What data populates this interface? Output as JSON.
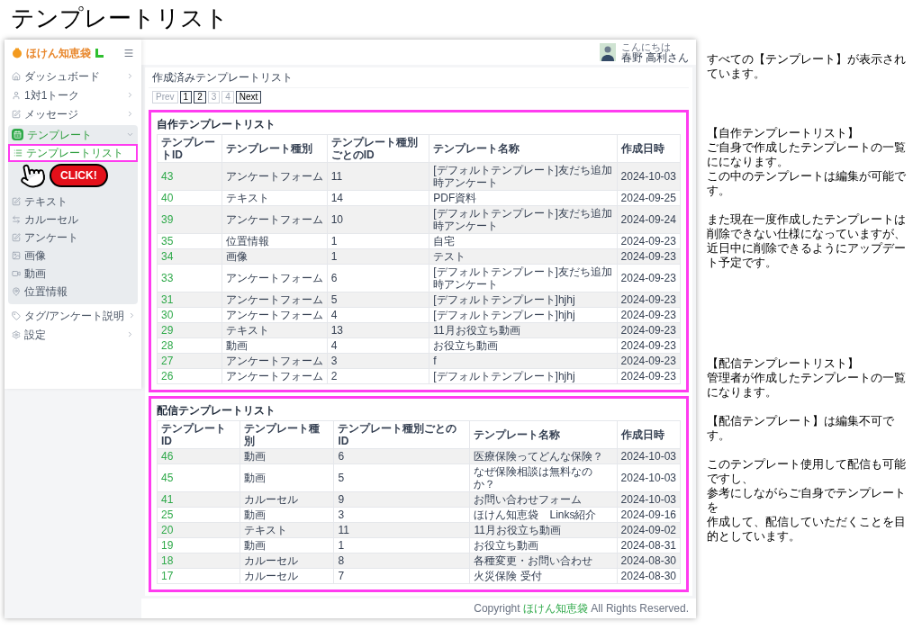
{
  "page_title": "テンプレートリスト",
  "app": {
    "logo": {
      "text": "ほけん知恵袋"
    },
    "sidebar": {
      "items": [
        {
          "label": "ダッシュボード",
          "expanded": false
        },
        {
          "label": "1対1トーク",
          "expanded": false
        },
        {
          "label": "メッセージ",
          "expanded": false
        },
        {
          "label": "テンプレート",
          "expanded": true,
          "children": [
            {
              "label": "テンプレートリスト",
              "selected": true
            },
            {
              "label": "テキスト",
              "selected": false
            },
            {
              "label": "カルーセル",
              "selected": false
            },
            {
              "label": "アンケート",
              "selected": false
            },
            {
              "label": "画像",
              "selected": false
            },
            {
              "label": "動画",
              "selected": false
            },
            {
              "label": "位置情報",
              "selected": false
            }
          ]
        },
        {
          "label": "タグ/アンケート説明",
          "expanded": false
        },
        {
          "label": "設定",
          "expanded": false
        }
      ]
    },
    "callout": {
      "text": "CLICK!"
    },
    "user": {
      "greeting": "こんにちは",
      "name": "春野 高利さん"
    },
    "card_title": "作成済みテンプレートリスト",
    "pagination": [
      {
        "label": "Prev",
        "disabled": true
      },
      {
        "label": "1",
        "disabled": false
      },
      {
        "label": "2",
        "disabled": false
      },
      {
        "label": "3",
        "disabled": true
      },
      {
        "label": "4",
        "disabled": true
      },
      {
        "label": "Next",
        "disabled": false
      }
    ],
    "tables": [
      {
        "title": "自作テンプレートリスト",
        "columns": [
          "テンプレートID",
          "テンプレート種別",
          "テンプレート種別ごとのID",
          "テンプレート名称",
          "作成日時"
        ],
        "rows": [
          [
            "43",
            "アンケートフォーム",
            "11",
            "[デフォルトテンプレート]友だち追加時アンケート",
            "2024-10-03"
          ],
          [
            "40",
            "テキスト",
            "14",
            "PDF資料",
            "2024-09-25"
          ],
          [
            "39",
            "アンケートフォーム",
            "10",
            "[デフォルトテンプレート]友だち追加時アンケート",
            "2024-09-24"
          ],
          [
            "35",
            "位置情報",
            "1",
            "自宅",
            "2024-09-23"
          ],
          [
            "34",
            "画像",
            "1",
            "テスト",
            "2024-09-23"
          ],
          [
            "33",
            "アンケートフォーム",
            "6",
            "[デフォルトテンプレート]友だち追加時アンケート",
            "2024-09-23"
          ],
          [
            "31",
            "アンケートフォーム",
            "5",
            "[デフォルトテンプレート]hjhj",
            "2024-09-23"
          ],
          [
            "30",
            "アンケートフォーム",
            "4",
            "[デフォルトテンプレート]hjhj",
            "2024-09-23"
          ],
          [
            "29",
            "テキスト",
            "13",
            "11月お役立ち動画",
            "2024-09-23"
          ],
          [
            "28",
            "動画",
            "4",
            "お役立ち動画",
            "2024-09-23"
          ],
          [
            "27",
            "アンケートフォーム",
            "3",
            "f",
            "2024-09-23"
          ],
          [
            "26",
            "アンケートフォーム",
            "2",
            "[デフォルトテンプレート]hjhj",
            "2024-09-23"
          ]
        ]
      },
      {
        "title": "配信テンプレートリスト",
        "columns": [
          "テンプレートID",
          "テンプレート種別",
          "テンプレート種別ごとのID",
          "テンプレート名称",
          "作成日時"
        ],
        "rows": [
          [
            "46",
            "動画",
            "6",
            "医療保険ってどんな保険？",
            "2024-10-03"
          ],
          [
            "45",
            "動画",
            "5",
            "なぜ保険相談は無料なのか？",
            "2024-10-03"
          ],
          [
            "41",
            "カルーセル",
            "9",
            "お問い合わせフォーム",
            "2024-10-03"
          ],
          [
            "25",
            "動画",
            "3",
            "ほけん知恵袋　Links紹介",
            "2024-09-16"
          ],
          [
            "20",
            "テキスト",
            "11",
            "11月お役立ち動画",
            "2024-09-02"
          ],
          [
            "19",
            "動画",
            "1",
            "お役立ち動画",
            "2024-08-31"
          ],
          [
            "18",
            "カルーセル",
            "8",
            "各種変更・お問い合わせ",
            "2024-08-30"
          ],
          [
            "17",
            "カルーセル",
            "7",
            "火災保険 受付",
            "2024-08-30"
          ]
        ]
      }
    ],
    "footer": {
      "prefix": "Copyright",
      "brand": "ほけん知恵袋",
      "suffix": "All Rights Reserved."
    }
  },
  "notes": [
    {
      "lines": [
        "すべての【テンプレート】が表示されています。"
      ]
    },
    {
      "lines": [
        "【自作テンプレートリスト】",
        "ご自身で作成したテンプレートの一覧にになります。",
        "この中のテンプレートは編集が可能です。"
      ]
    },
    {
      "lines": [
        "また現在一度作成したテンプレートは削除できない仕様になっていますが、近日中に削除できるようにアップデート予定です。"
      ]
    },
    {
      "lines": [
        "【配信テンプレートリスト】",
        "管理者が作成したテンプレートの一覧になります。"
      ]
    },
    {
      "lines": [
        "【配信テンプレート】は編集不可です。"
      ]
    },
    {
      "lines": [
        "このテンプレート使用して配信も可能ですし、",
        "参考にしながらご自身でテンプレートを",
        "作成して、配信していただくことを目的としています。"
      ]
    }
  ]
}
